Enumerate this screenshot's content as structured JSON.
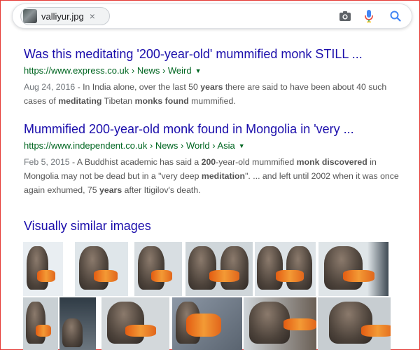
{
  "search": {
    "chip_filename": "valliyur.jpg",
    "chip_close": "×",
    "icons": [
      "camera-icon",
      "microphone-icon",
      "search-icon"
    ],
    "colors": {
      "mic": "#4285f4",
      "search": "#4285f4",
      "camera": "#5f6368"
    }
  },
  "results": [
    {
      "title": "Was this meditating '200-year-old' mummified monk STILL ...",
      "url": "https://www.express.co.uk › News › Weird",
      "caret": "▼",
      "date": "Aug 24, 2016",
      "snippet_parts": [
        {
          "t": " - In India alone, over the last 50 ",
          "b": false
        },
        {
          "t": "years",
          "b": true
        },
        {
          "t": " there are said to have been about 40 such cases of ",
          "b": false
        },
        {
          "t": "meditating",
          "b": true
        },
        {
          "t": " Tibetan ",
          "b": false
        },
        {
          "t": "monks found",
          "b": true
        },
        {
          "t": " mummified.",
          "b": false
        }
      ]
    },
    {
      "title": "Mummified 200-year-old monk found in Mongolia in 'very ...",
      "url": "https://www.independent.co.uk › News › World › Asia",
      "caret": "▼",
      "date": "Feb 5, 2015",
      "snippet_parts": [
        {
          "t": " - A Buddhist academic has said a ",
          "b": false
        },
        {
          "t": "200",
          "b": true
        },
        {
          "t": "-year-old mummified ",
          "b": false
        },
        {
          "t": "monk discovered",
          "b": true
        },
        {
          "t": " in Mongolia may not be dead but in a \"very deep ",
          "b": false
        },
        {
          "t": "meditation",
          "b": true
        },
        {
          "t": "\". ... and left until 2002 when it was once again exhumed, 75 ",
          "b": false
        },
        {
          "t": "years",
          "b": true
        },
        {
          "t": " after Itigilov's death.",
          "b": false
        }
      ]
    }
  ],
  "visually_similar": {
    "title": "Visually similar images",
    "rows": [
      [
        "monk-thumb-1",
        "monk-thumb-2",
        "monk-thumb-3",
        "monk-thumb-4",
        "monk-thumb-5",
        "monk-thumb-6"
      ],
      [
        "monk-thumb-7",
        "monk-thumb-8",
        "monk-thumb-9",
        "monk-thumb-10",
        "monk-thumb-11",
        "monk-thumb-12"
      ]
    ]
  }
}
